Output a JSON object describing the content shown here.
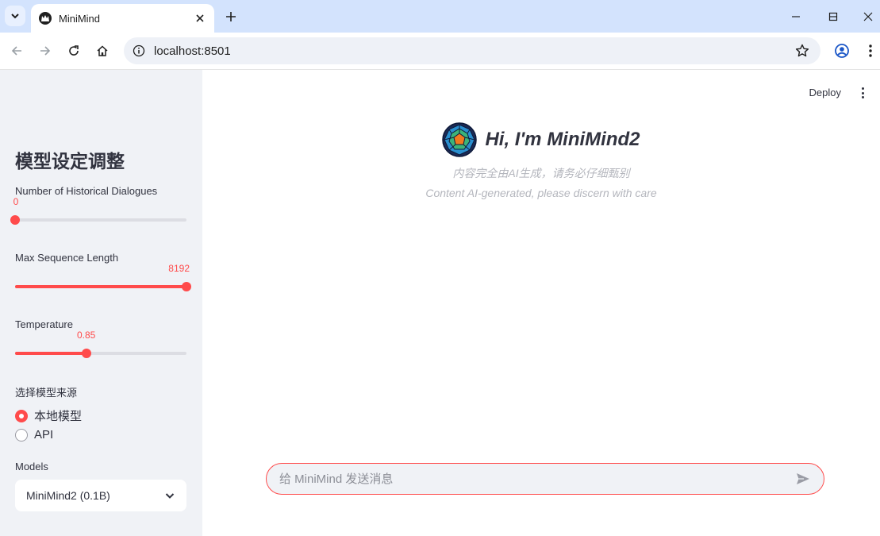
{
  "browser": {
    "tab_title": "MiniMind",
    "url": "localhost:8501"
  },
  "sidebar": {
    "title": "模型设定调整",
    "sliders": [
      {
        "label": "Number of Historical Dialogues",
        "value": "0",
        "fraction": 0.0
      },
      {
        "label": "Max Sequence Length",
        "value": "8192",
        "fraction": 1.0
      },
      {
        "label": "Temperature",
        "value": "0.85",
        "fraction": 0.415
      }
    ],
    "model_source": {
      "label": "选择模型来源",
      "options": [
        {
          "label": "本地模型",
          "selected": true
        },
        {
          "label": "API",
          "selected": false
        }
      ]
    },
    "models": {
      "label": "Models",
      "selected": "MiniMind2 (0.1B)"
    }
  },
  "main": {
    "deploy_label": "Deploy",
    "title": "Hi, I'm MiniMind2",
    "subtitle_cn": "内容完全由AI生成，请务必仔细甄别",
    "subtitle_en": "Content AI-generated, please discern with care",
    "chat_placeholder": "给 MiniMind 发送消息"
  },
  "colors": {
    "accent": "#ff4b4b",
    "sidebar_bg": "#f0f2f6",
    "tabbar_bg": "#d3e3fd"
  }
}
